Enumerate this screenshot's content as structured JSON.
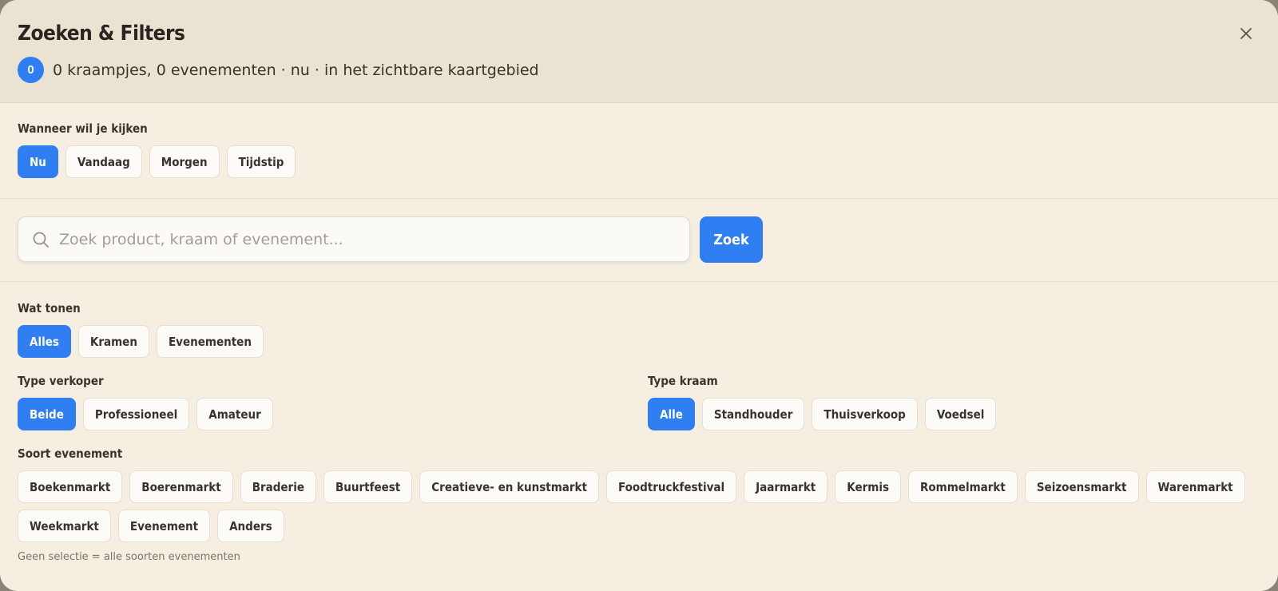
{
  "header": {
    "title": "Zoeken & Filters",
    "count": "0",
    "summary": "0 kraampjes, 0 evenementen · nu · in het zichtbare kaartgebied",
    "close_icon": "close-icon"
  },
  "when": {
    "label": "Wanneer wil je kijken",
    "options": [
      "Nu",
      "Vandaag",
      "Morgen",
      "Tijdstip"
    ],
    "selected": "Nu"
  },
  "search": {
    "placeholder": "Zoek product, kraam of evenement...",
    "value": "",
    "button_label": "Zoek",
    "icon": "search-icon"
  },
  "show": {
    "label": "Wat tonen",
    "options": [
      "Alles",
      "Kramen",
      "Evenementen"
    ],
    "selected": "Alles"
  },
  "seller": {
    "label": "Type verkoper",
    "options": [
      "Beide",
      "Professioneel",
      "Amateur"
    ],
    "selected": "Beide"
  },
  "stall": {
    "label": "Type kraam",
    "options": [
      "Alle",
      "Standhouder",
      "Thuisverkoop",
      "Voedsel"
    ],
    "selected": "Alle"
  },
  "event_kind": {
    "label": "Soort evenement",
    "options": [
      "Boekenmarkt",
      "Boerenmarkt",
      "Braderie",
      "Buurtfeest",
      "Creatieve- en kunstmarkt",
      "Foodtruckfestival",
      "Jaarmarkt",
      "Kermis",
      "Rommelmarkt",
      "Seizoensmarkt",
      "Warenmarkt",
      "Weekmarkt",
      "Evenement",
      "Anders"
    ],
    "hint": "Geen selectie = alle soorten evenementen"
  },
  "colors": {
    "accent": "#2f7ff2",
    "panel_bg": "#f5eee1",
    "header_bg": "#ebe3d1"
  }
}
